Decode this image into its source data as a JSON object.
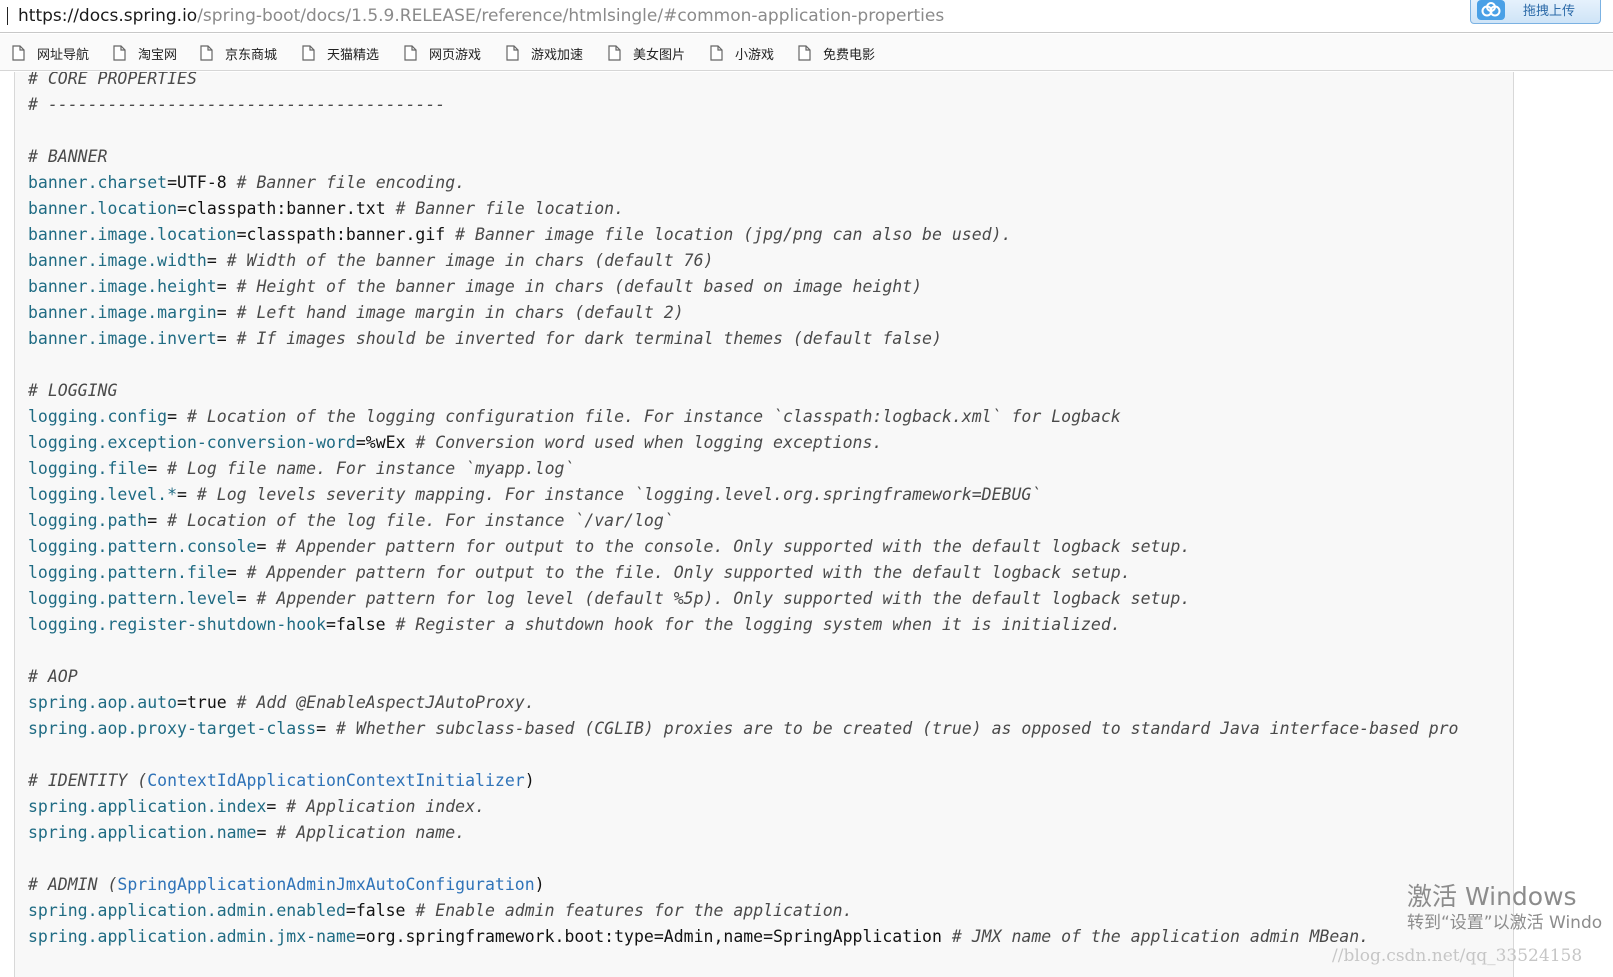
{
  "browser": {
    "url_host": "https://docs.spring.io",
    "url_path": "/spring-boot/docs/1.5.9.RELEASE/reference/htmlsingle/#common-application-properties",
    "upload_button_label": "拖拽上传",
    "upload_icon": "cloud-icon"
  },
  "bookmarks": [
    {
      "label": "网址导航",
      "icon": "page-icon"
    },
    {
      "label": "淘宝网",
      "icon": "page-icon"
    },
    {
      "label": "京东商城",
      "icon": "page-icon"
    },
    {
      "label": "天猫精选",
      "icon": "page-icon"
    },
    {
      "label": "网页游戏",
      "icon": "page-icon"
    },
    {
      "label": "游戏加速",
      "icon": "page-icon"
    },
    {
      "label": "美女图片",
      "icon": "page-icon"
    },
    {
      "label": "小游戏",
      "icon": "page-icon"
    },
    {
      "label": "免费电影",
      "icon": "page-icon"
    }
  ],
  "code_lines": [
    [
      {
        "t": "c",
        "v": "# CORE PROPERTIES"
      }
    ],
    [
      {
        "t": "c",
        "v": "# ----------------------------------------"
      }
    ],
    [],
    [
      {
        "t": "c",
        "v": "# BANNER"
      }
    ],
    [
      {
        "t": "k",
        "v": "banner.charset"
      },
      {
        "t": "p",
        "v": "=UTF-8 "
      },
      {
        "t": "c",
        "v": "# Banner file encoding."
      }
    ],
    [
      {
        "t": "k",
        "v": "banner.location"
      },
      {
        "t": "p",
        "v": "=classpath:banner.txt "
      },
      {
        "t": "c",
        "v": "# Banner file location."
      }
    ],
    [
      {
        "t": "k",
        "v": "banner.image.location"
      },
      {
        "t": "p",
        "v": "=classpath:banner.gif "
      },
      {
        "t": "c",
        "v": "# Banner image file location (jpg/png can also be used)."
      }
    ],
    [
      {
        "t": "k",
        "v": "banner.image.width"
      },
      {
        "t": "p",
        "v": "= "
      },
      {
        "t": "c",
        "v": "# Width of the banner image in chars (default 76)"
      }
    ],
    [
      {
        "t": "k",
        "v": "banner.image.height"
      },
      {
        "t": "p",
        "v": "= "
      },
      {
        "t": "c",
        "v": "# Height of the banner image in chars (default based on image height)"
      }
    ],
    [
      {
        "t": "k",
        "v": "banner.image.margin"
      },
      {
        "t": "p",
        "v": "= "
      },
      {
        "t": "c",
        "v": "# Left hand image margin in chars (default 2)"
      }
    ],
    [
      {
        "t": "k",
        "v": "banner.image.invert"
      },
      {
        "t": "p",
        "v": "= "
      },
      {
        "t": "c",
        "v": "# If images should be inverted for dark terminal themes (default false)"
      }
    ],
    [],
    [
      {
        "t": "c",
        "v": "# LOGGING"
      }
    ],
    [
      {
        "t": "k",
        "v": "logging.config"
      },
      {
        "t": "p",
        "v": "= "
      },
      {
        "t": "c",
        "v": "# Location of the logging configuration file. For instance `classpath:logback.xml` for Logback"
      }
    ],
    [
      {
        "t": "k",
        "v": "logging.exception-conversion-word"
      },
      {
        "t": "p",
        "v": "=%wEx "
      },
      {
        "t": "c",
        "v": "# Conversion word used when logging exceptions."
      }
    ],
    [
      {
        "t": "k",
        "v": "logging.file"
      },
      {
        "t": "p",
        "v": "= "
      },
      {
        "t": "c",
        "v": "# Log file name. For instance `myapp.log`"
      }
    ],
    [
      {
        "t": "k",
        "v": "logging.level.*"
      },
      {
        "t": "p",
        "v": "= "
      },
      {
        "t": "c",
        "v": "# Log levels severity mapping. For instance `logging.level.org.springframework=DEBUG`"
      }
    ],
    [
      {
        "t": "k",
        "v": "logging.path"
      },
      {
        "t": "p",
        "v": "= "
      },
      {
        "t": "c",
        "v": "# Location of the log file. For instance `/var/log`"
      }
    ],
    [
      {
        "t": "k",
        "v": "logging.pattern.console"
      },
      {
        "t": "p",
        "v": "= "
      },
      {
        "t": "c",
        "v": "# Appender pattern for output to the console. Only supported with the default logback setup."
      }
    ],
    [
      {
        "t": "k",
        "v": "logging.pattern.file"
      },
      {
        "t": "p",
        "v": "= "
      },
      {
        "t": "c",
        "v": "# Appender pattern for output to the file. Only supported with the default logback setup."
      }
    ],
    [
      {
        "t": "k",
        "v": "logging.pattern.level"
      },
      {
        "t": "p",
        "v": "= "
      },
      {
        "t": "c",
        "v": "# Appender pattern for log level (default %5p). Only supported with the default logback setup."
      }
    ],
    [
      {
        "t": "k",
        "v": "logging.register-shutdown-hook"
      },
      {
        "t": "p",
        "v": "=false "
      },
      {
        "t": "c",
        "v": "# Register a shutdown hook for the logging system when it is initialized."
      }
    ],
    [],
    [
      {
        "t": "c",
        "v": "# AOP"
      }
    ],
    [
      {
        "t": "k",
        "v": "spring.aop.auto"
      },
      {
        "t": "p",
        "v": "=true "
      },
      {
        "t": "c",
        "v": "# Add @EnableAspectJAutoProxy."
      }
    ],
    [
      {
        "t": "k",
        "v": "spring.aop.proxy-target-class"
      },
      {
        "t": "p",
        "v": "= "
      },
      {
        "t": "c",
        "v": "# Whether subclass-based (CGLIB) proxies are to be created (true) as opposed to standard Java interface-based pro"
      }
    ],
    [],
    [
      {
        "t": "c",
        "v": "# IDENTITY ("
      },
      {
        "t": "l",
        "v": "ContextIdApplicationContextInitializer"
      },
      {
        "t": "p",
        "v": ")"
      }
    ],
    [
      {
        "t": "k",
        "v": "spring.application.index"
      },
      {
        "t": "p",
        "v": "= "
      },
      {
        "t": "c",
        "v": "# Application index."
      }
    ],
    [
      {
        "t": "k",
        "v": "spring.application.name"
      },
      {
        "t": "p",
        "v": "= "
      },
      {
        "t": "c",
        "v": "# Application name."
      }
    ],
    [],
    [
      {
        "t": "c",
        "v": "# ADMIN ("
      },
      {
        "t": "l",
        "v": "SpringApplicationAdminJmxAutoConfiguration"
      },
      {
        "t": "p",
        "v": ")"
      }
    ],
    [
      {
        "t": "k",
        "v": "spring.application.admin.enabled"
      },
      {
        "t": "p",
        "v": "=false "
      },
      {
        "t": "c",
        "v": "# Enable admin features for the application."
      }
    ],
    [
      {
        "t": "k",
        "v": "spring.application.admin.jmx-name"
      },
      {
        "t": "p",
        "v": "=org.springframework.boot:type=Admin,name=SpringApplication "
      },
      {
        "t": "c",
        "v": "# JMX name of the application admin MBean."
      }
    ]
  ],
  "watermark": {
    "title": "激活 Windows",
    "subtitle": "转到“设置”以激活 Windo",
    "blog": "//blog.csdn.net/qq_33524158"
  },
  "colors": {
    "key": "#1f6b83",
    "comment": "#4a4a4a",
    "link": "#2f73b8",
    "panel_bg": "#f8f8f8"
  }
}
